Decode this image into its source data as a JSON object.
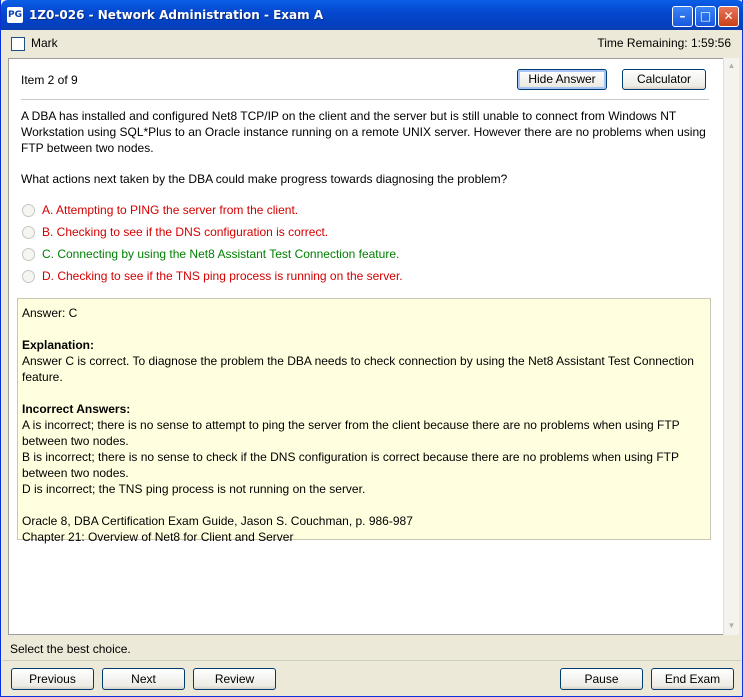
{
  "window": {
    "title": "1Z0-026 - Network Administration - Exam A",
    "icon_text": "PG"
  },
  "topbar": {
    "mark_label": "Mark",
    "time_remaining": "Time Remaining: 1:59:56"
  },
  "item": {
    "label": "Item 2 of 9",
    "hide_answer_label": "Hide Answer",
    "calculator_label": "Calculator"
  },
  "question": {
    "text": "A DBA has installed and configured Net8 TCP/IP on the client and the server but is still unable to connect from Windows NT Workstation using SQL*Plus to an Oracle instance running on a remote UNIX server. However there are no problems when using FTP between two nodes.",
    "prompt": "What actions next taken by the DBA could make progress towards diagnosing the problem?"
  },
  "options": [
    {
      "text": "A.  Attempting to PING the server from the client.",
      "status": "incorrect"
    },
    {
      "text": "B.  Checking to see if the DNS configuration is correct.",
      "status": "incorrect"
    },
    {
      "text": "C.  Connecting by using the Net8 Assistant Test Connection feature.",
      "status": "correct"
    },
    {
      "text": "D.  Checking to see if the TNS ping process is running on the server.",
      "status": "incorrect"
    }
  ],
  "answer": {
    "answer_line": "Answer: C",
    "explanation_heading": "Explanation:",
    "explanation": "Answer C is correct. To diagnose the problem the DBA needs to check connection by using the Net8 Assistant Test Connection feature.",
    "incorrect_heading": "Incorrect Answers:",
    "incorrect": [
      "A is incorrect; there is no sense to attempt to ping the server from the client because there are no problems when using FTP between two nodes.",
      "B is incorrect; there is no sense to check if the DNS configuration is correct because there are no problems when using FTP between two nodes.",
      "D is incorrect; the TNS ping process is not running on the server."
    ],
    "reference_1": "Oracle 8, DBA Certification Exam Guide, Jason S. Couchman, p. 986-987",
    "reference_2": "Chapter 21: Overview of Net8 for Client and Server"
  },
  "status_text": "Select the best choice.",
  "nav": {
    "previous": "Previous",
    "next": "Next",
    "review": "Review",
    "pause": "Pause",
    "end_exam": "End Exam"
  },
  "colors": {
    "correct": "#008000",
    "incorrect": "#d40000",
    "answer_bg": "#ffffe0"
  }
}
